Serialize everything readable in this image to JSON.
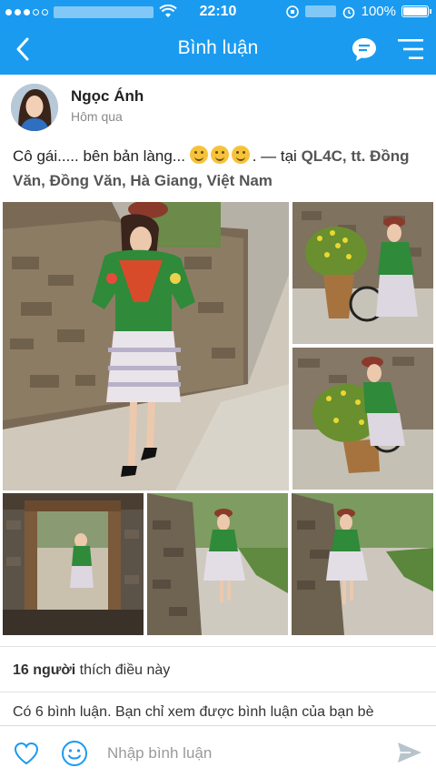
{
  "status_bar": {
    "time": "22:10",
    "battery": "100%"
  },
  "nav": {
    "title": "Bình luận",
    "icons": [
      "back-arrow-icon",
      "chat-bubble-icon",
      "menu-icon"
    ]
  },
  "post": {
    "author": "Ngọc Ánh",
    "time": "Hôm qua",
    "text_main": "Cô gái..... bên bản làng...",
    "text_sep": ". — tại",
    "location_part1": "QL4C, tt.",
    "location_part2": "Đồng Văn, Đồng Văn, Hà Giang, Việt Nam"
  },
  "likes": {
    "count": "16 người",
    "suffix": " thích điều này"
  },
  "comments_info": "Có 6 bình luận. Bạn chỉ xem được bình luận của bạn bè",
  "input": {
    "placeholder": "Nhập bình luận"
  },
  "colors": {
    "accent": "#1a9bf0",
    "send_icon": "#b8c4cc"
  }
}
